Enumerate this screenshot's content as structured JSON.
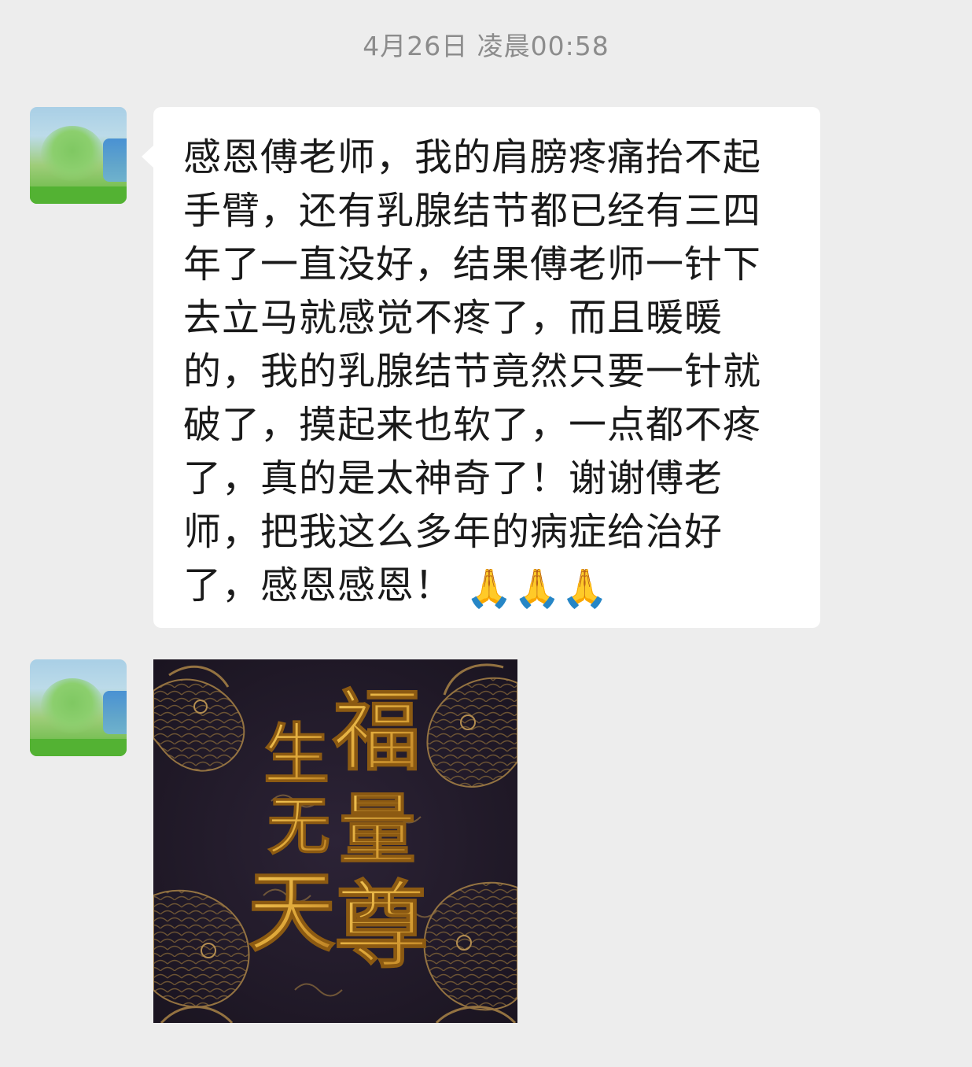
{
  "chat": {
    "timestamp": "4月26日 凌晨00:58",
    "messages": [
      {
        "type": "text",
        "text": "感恩傅老师，我的肩膀疼痛抬不起手臂，还有乳腺结节都已经有三四年了一直没好，结果傅老师一针下去立马就感觉不疼了，而且暖暖的，我的乳腺结节竟然只要一针就破了，摸起来也软了，一点都不疼了，真的是太神奇了！谢谢傅老师，把我这么多年的病症给治好了，感恩感恩！",
        "emoji": [
          "🙏",
          "🙏",
          "🙏"
        ]
      },
      {
        "type": "image",
        "image_text": {
          "char1": "福",
          "char2": "生",
          "char3": "量",
          "char4": "无",
          "char5": "天",
          "char6": "尊"
        }
      }
    ]
  },
  "colors": {
    "background": "#ededed",
    "bubble": "#ffffff",
    "timestamp": "#8c8c8c",
    "image_bg": "#231c2b",
    "gold": "#e0a93a"
  }
}
